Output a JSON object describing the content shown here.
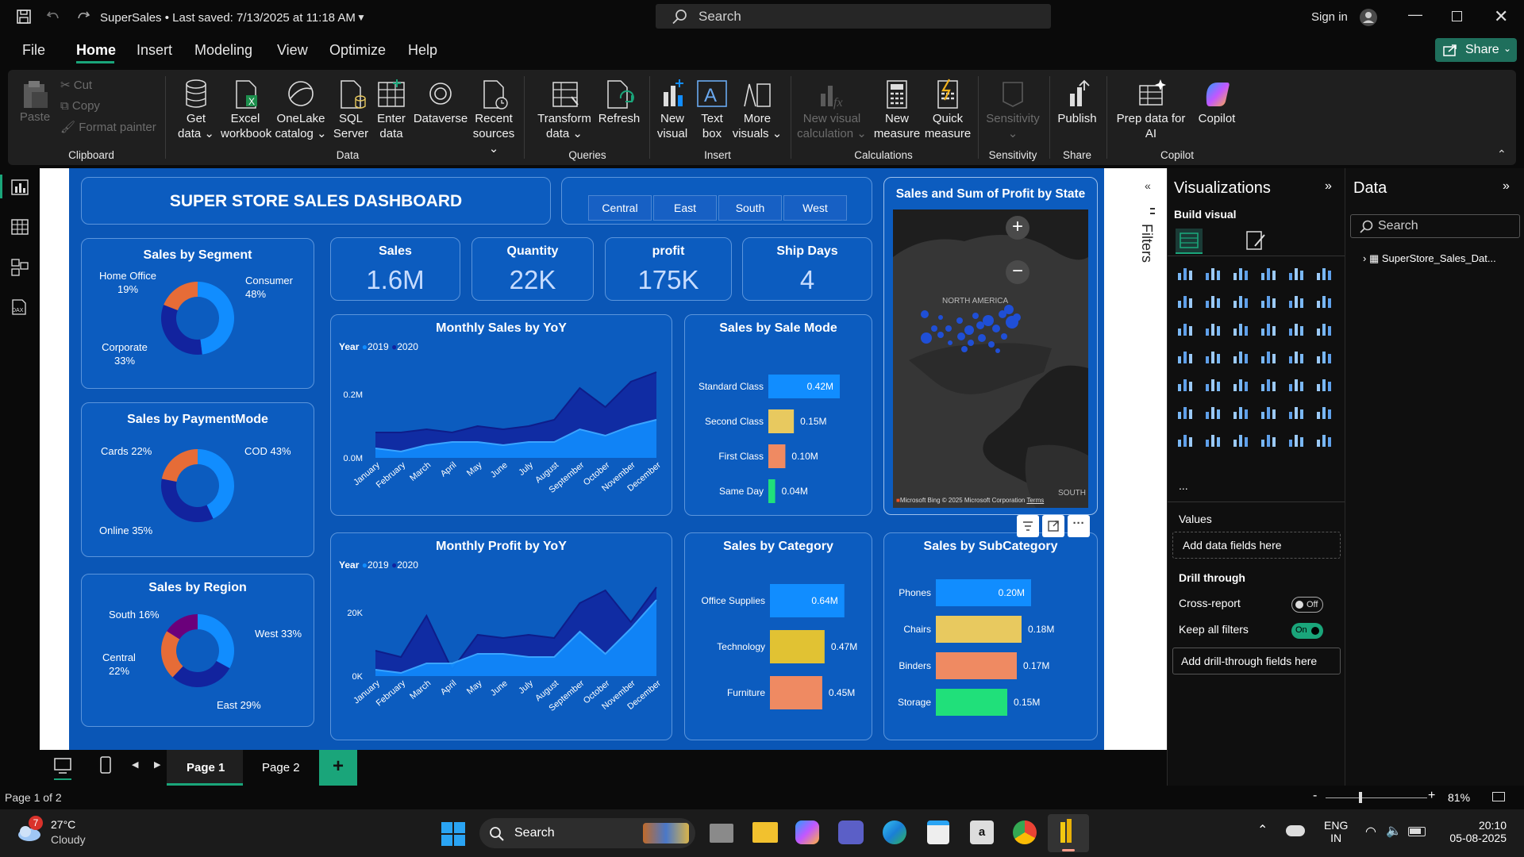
{
  "titlebar": {
    "title": "SuperSales • Last saved: 7/13/2025 at 11:18 AM",
    "search_placeholder": "Search",
    "sign_in": "Sign in"
  },
  "menu": [
    "File",
    "Home",
    "Insert",
    "Modeling",
    "View",
    "Optimize",
    "Help"
  ],
  "share_label": "Share",
  "ribbon": {
    "clipboard": {
      "paste": "Paste",
      "cut": "Cut",
      "copy": "Copy",
      "format_painter": "Format painter",
      "group": "Clipboard"
    },
    "data": {
      "get_data": [
        "Get",
        "data"
      ],
      "excel": [
        "Excel",
        "workbook"
      ],
      "onelake": [
        "OneLake",
        "catalog"
      ],
      "sql": [
        "SQL",
        "Server"
      ],
      "enter": [
        "Enter",
        "data"
      ],
      "dataverse": "Dataverse",
      "recent": [
        "Recent",
        "sources"
      ],
      "group": "Data"
    },
    "queries": {
      "transform": [
        "Transform",
        "data"
      ],
      "refresh": "Refresh",
      "group": "Queries"
    },
    "insert": {
      "new_visual": [
        "New",
        "visual"
      ],
      "text_box": [
        "Text",
        "box"
      ],
      "more_visuals": [
        "More",
        "visuals"
      ],
      "group": "Insert"
    },
    "calculations": {
      "new_visual_calc": [
        "New visual",
        "calculation"
      ],
      "new_measure": [
        "New",
        "measure"
      ],
      "quick_measure": [
        "Quick",
        "measure"
      ],
      "group": "Calculations"
    },
    "sensitivity": {
      "label": "Sensitivity",
      "group": "Sensitivity"
    },
    "share": {
      "publish": "Publish",
      "group": "Share"
    },
    "copilot": {
      "prep": [
        "Prep data for",
        "AI"
      ],
      "copilot": "Copilot",
      "group": "Copilot"
    }
  },
  "dashboard": {
    "title": "SUPER STORE SALES DASHBOARD",
    "regions": [
      "Central",
      "East",
      "South",
      "West"
    ],
    "kpis": [
      {
        "label": "Sales",
        "value": "1.6M"
      },
      {
        "label": "Quantity",
        "value": "22K"
      },
      {
        "label": "profit",
        "value": "175K"
      },
      {
        "label": "Ship Days",
        "value": "4"
      }
    ],
    "segment": {
      "title": "Sales by Segment",
      "slices": [
        {
          "name": "Consumer",
          "pct": "48%",
          "value": 48,
          "color": "#118dff"
        },
        {
          "name": "Corporate",
          "pct": "33%",
          "value": 33,
          "color": "#12239e"
        },
        {
          "name": "Home Office",
          "pct": "19%",
          "value": 19,
          "color": "#e66c37"
        }
      ]
    },
    "payment": {
      "title": "Sales by PaymentMode",
      "slices": [
        {
          "name": "COD",
          "pct": "43%",
          "value": 43,
          "color": "#118dff"
        },
        {
          "name": "Online",
          "pct": "35%",
          "value": 35,
          "color": "#12239e"
        },
        {
          "name": "Cards",
          "pct": "22%",
          "value": 22,
          "color": "#e66c37"
        }
      ],
      "labels": [
        "COD 43%",
        "Online 35%",
        "Cards 22%"
      ]
    },
    "region": {
      "title": "Sales by Region",
      "slices": [
        {
          "name": "West",
          "pct": "33%",
          "value": 33,
          "color": "#118dff"
        },
        {
          "name": "East",
          "pct": "29%",
          "value": 29,
          "color": "#12239e"
        },
        {
          "name": "Central",
          "pct": "22%",
          "value": 22,
          "color": "#e66c37"
        },
        {
          "name": "South",
          "pct": "16%",
          "value": 16,
          "color": "#6b007b"
        }
      ],
      "labels": [
        "West 33%",
        "East 29%",
        "Central",
        "22%",
        "South 16%"
      ]
    },
    "monthly_sales": {
      "title": "Monthly Sales by YoY",
      "legend_title": "Year",
      "series_names": [
        "2019",
        "2020"
      ],
      "y_ticks": [
        "0.2M",
        "0.0M"
      ]
    },
    "monthly_profit": {
      "title": "Monthly Profit by YoY",
      "legend_title": "Year",
      "series_names": [
        "2019",
        "2020"
      ],
      "y_ticks": [
        "20K",
        "0K"
      ]
    },
    "months": [
      "January",
      "February",
      "March",
      "April",
      "May",
      "June",
      "July",
      "August",
      "September",
      "October",
      "November",
      "December"
    ],
    "sale_mode": {
      "title": "Sales by Sale Mode"
    },
    "category": {
      "title": "Sales by Category"
    },
    "subcategory": {
      "title": "Sales by SubCategory"
    },
    "map": {
      "title": "Sales and Sum of Profit by State",
      "region_label": "NORTH AMERICA",
      "south_label": "SOUTH",
      "credit": "Microsoft Bing",
      "copyright": "© 2025 Microsoft Corporation",
      "terms": "Terms"
    }
  },
  "chart_data": [
    {
      "type": "pie",
      "title": "Sales by Segment",
      "categories": [
        "Consumer",
        "Corporate",
        "Home Office"
      ],
      "values": [
        48,
        33,
        19
      ]
    },
    {
      "type": "pie",
      "title": "Sales by PaymentMode",
      "categories": [
        "COD",
        "Online",
        "Cards"
      ],
      "values": [
        43,
        35,
        22
      ]
    },
    {
      "type": "pie",
      "title": "Sales by Region",
      "categories": [
        "West",
        "East",
        "Central",
        "South"
      ],
      "values": [
        33,
        29,
        22,
        16
      ]
    },
    {
      "type": "area",
      "title": "Monthly Sales by YoY",
      "categories": [
        "January",
        "February",
        "March",
        "April",
        "May",
        "June",
        "July",
        "August",
        "September",
        "October",
        "November",
        "December"
      ],
      "series": [
        {
          "name": "2019",
          "values": [
            0.03,
            0.02,
            0.04,
            0.05,
            0.05,
            0.04,
            0.05,
            0.05,
            0.09,
            0.07,
            0.1,
            0.12
          ]
        },
        {
          "name": "2020",
          "values": [
            0.08,
            0.08,
            0.09,
            0.08,
            0.1,
            0.09,
            0.1,
            0.12,
            0.22,
            0.16,
            0.24,
            0.27
          ]
        }
      ],
      "ylim": [
        0,
        0.3
      ]
    },
    {
      "type": "area",
      "title": "Monthly Profit by YoY",
      "categories": [
        "January",
        "February",
        "March",
        "April",
        "May",
        "June",
        "July",
        "August",
        "September",
        "October",
        "November",
        "December"
      ],
      "series": [
        {
          "name": "2019",
          "values": [
            2,
            1,
            4,
            4,
            7,
            7,
            6,
            6,
            14,
            7,
            15,
            24
          ]
        },
        {
          "name": "2020",
          "values": [
            8,
            6,
            19,
            2,
            13,
            12,
            13,
            12,
            23,
            27,
            17,
            28
          ]
        }
      ],
      "ylim": [
        0,
        30
      ]
    },
    {
      "type": "bar",
      "title": "Sales by Sale Mode",
      "categories": [
        "Standard Class",
        "Second Class",
        "First Class",
        "Same Day"
      ],
      "values": [
        0.42,
        0.15,
        0.1,
        0.04
      ],
      "labels": [
        "0.42M",
        "0.15M",
        "0.10M",
        "0.04M"
      ],
      "colors": [
        "#118dff",
        "#e8c95f",
        "#ef8a62",
        "#20e07a"
      ]
    },
    {
      "type": "bar",
      "title": "Sales by Category",
      "categories": [
        "Office Supplies",
        "Technology",
        "Furniture"
      ],
      "values": [
        0.64,
        0.47,
        0.45
      ],
      "labels": [
        "0.64M",
        "0.47M",
        "0.45M"
      ],
      "colors": [
        "#118dff",
        "#e1c233",
        "#ef8a62"
      ]
    },
    {
      "type": "bar",
      "title": "Sales by SubCategory",
      "categories": [
        "Phones",
        "Chairs",
        "Binders",
        "Storage"
      ],
      "values": [
        0.2,
        0.18,
        0.17,
        0.15
      ],
      "labels": [
        "0.20M",
        "0.18M",
        "0.17M",
        "0.15M"
      ],
      "colors": [
        "#118dff",
        "#e8c95f",
        "#ef8a62",
        "#20e07a"
      ]
    }
  ],
  "filters_label": "Filters",
  "visualizations": {
    "title": "Visualizations",
    "build_visual": "Build visual",
    "values": "Values",
    "add_fields": "Add data fields here",
    "drill_through": "Drill through",
    "cross_report": "Cross-report",
    "cross_report_state": "Off",
    "keep_filters": "Keep all filters",
    "keep_filters_state": "On",
    "add_drill": "Add drill-through fields here",
    "more": "..."
  },
  "data_pane": {
    "title": "Data",
    "search_placeholder": "Search",
    "table": "SuperStore_Sales_Dat..."
  },
  "pages": [
    "Page 1",
    "Page 2"
  ],
  "status": {
    "page": "Page 1 of 2",
    "zoom": "81%"
  },
  "taskbar": {
    "weather_temp": "27°C",
    "weather_desc": "Cloudy",
    "badge": "7",
    "search": "Search",
    "lang1": "ENG",
    "lang2": "IN",
    "time": "20:10",
    "date": "05-08-2025"
  }
}
